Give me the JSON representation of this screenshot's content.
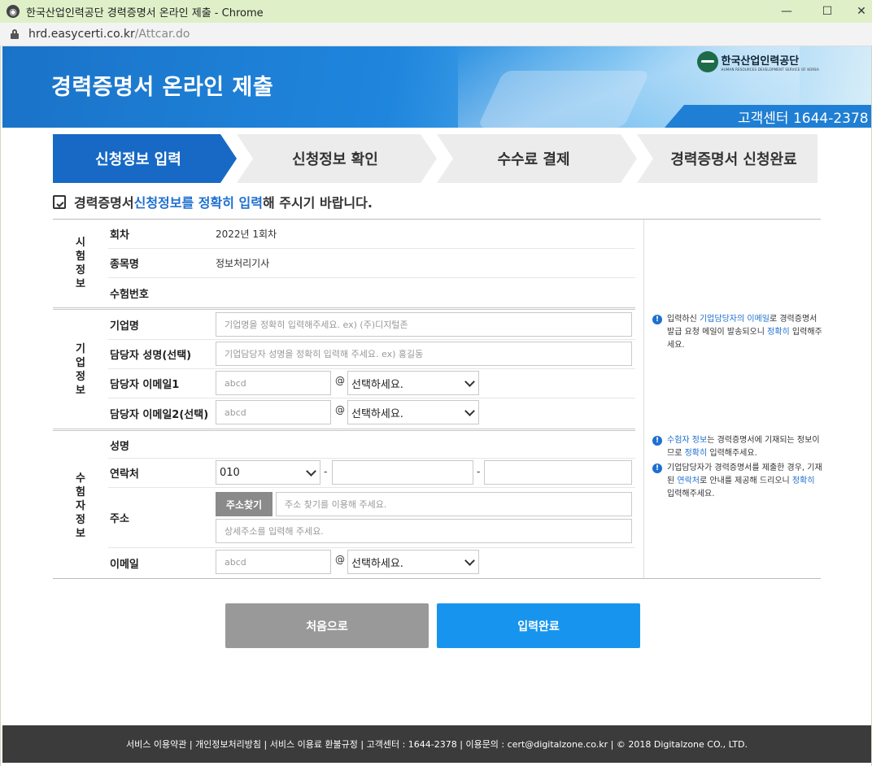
{
  "browser": {
    "window_title": "한국산업인력공단 경력증명서 온라인 제출 - Chrome",
    "url_host": "hrd.easycerti.co.kr",
    "url_path": "/Attcar.do",
    "controls": {
      "minimize": "—",
      "maximize": "☐",
      "close": "✕"
    }
  },
  "header": {
    "title": "경력증명서 온라인 제출",
    "logo_kor": "한국산업인력공단",
    "logo_eng": "HUMAN RESOURCES DEVELOPMENT SERVICE OF KOREA",
    "callcenter": "고객센터 1644-2378"
  },
  "steps": [
    {
      "label": "신청정보 입력",
      "active": true
    },
    {
      "label": "신청정보 확인",
      "active": false
    },
    {
      "label": "수수료 결제",
      "active": false
    },
    {
      "label": "경력증명서 신청완료",
      "active": false
    }
  ],
  "notice": {
    "before": "경력증명서 ",
    "highlight": "신청정보를 정확히 입력",
    "after": "해 주시기 바랍니다."
  },
  "exam": {
    "title": "시험정보",
    "round_label": "회차",
    "round_value": "2022년 1회차",
    "subject_label": "종목명",
    "subject_value": "정보처리기사",
    "number_label": "수험번호",
    "number_value": ""
  },
  "company": {
    "title": "기업정보",
    "name_label": "기업명",
    "name_placeholder": "기업명을 정확히 입력해주세요. ex) (주)디지털존",
    "manager_label": "담당자 성명(선택)",
    "manager_placeholder": "기업담당자 성명을 정확히 입력해 주세요. ex) 홍길동",
    "email1_label": "담당자 이메일1",
    "email2_label": "담당자 이메일2(선택)",
    "email_placeholder": "abcd",
    "at": "@",
    "domain_select": "선택하세요."
  },
  "applicant": {
    "title": "수험자정보",
    "name_label": "성명",
    "phone_label": "연락처",
    "phone_prefix": "010",
    "dash": "-",
    "address_label": "주소",
    "address_button": "주소찾기",
    "address_placeholder": "주소 찾기를 이용해 주세요.",
    "address_detail_placeholder": "상세주소를 입력해 주세요.",
    "email_label": "이메일",
    "email_placeholder": "abcd",
    "at": "@",
    "domain_select": "선택하세요."
  },
  "help": {
    "company": {
      "t1": "입력하신 ",
      "b1": "기업담당자의 이메일",
      "t2": "로 경력증명서 발급 요청 메일이 발송되오니 ",
      "b2": "정확히",
      "t3": " 입력해주세요."
    },
    "applicant1": {
      "b1": "수험자 정보",
      "t1": "는 경력증명서에 기재되는 정보이므로 ",
      "b2": "정확히",
      "t2": " 입력해주세요."
    },
    "applicant2": {
      "t1": "기업담당자가 경력증명서를 제출한 경우, 기재된 ",
      "b1": "연락처",
      "t2": "로 안내를 제공해 드리오니 ",
      "b2": "정확히",
      "t3": " 입력해주세요."
    }
  },
  "buttons": {
    "reset": "처음으로",
    "submit": "입력완료"
  },
  "footer": "서비스 이용약관 | 개인정보처리방침 | 서비스 이용료 환불규정 | 고객센터 : 1644-2378 | 이용문의 : cert@digitalzone.co.kr | © 2018 Digitalzone CO., LTD.",
  "colors": {
    "primary": "#1769c5",
    "accent": "#1795ee",
    "titlebar": "#dff0c9",
    "footer": "#3b3b3b"
  }
}
